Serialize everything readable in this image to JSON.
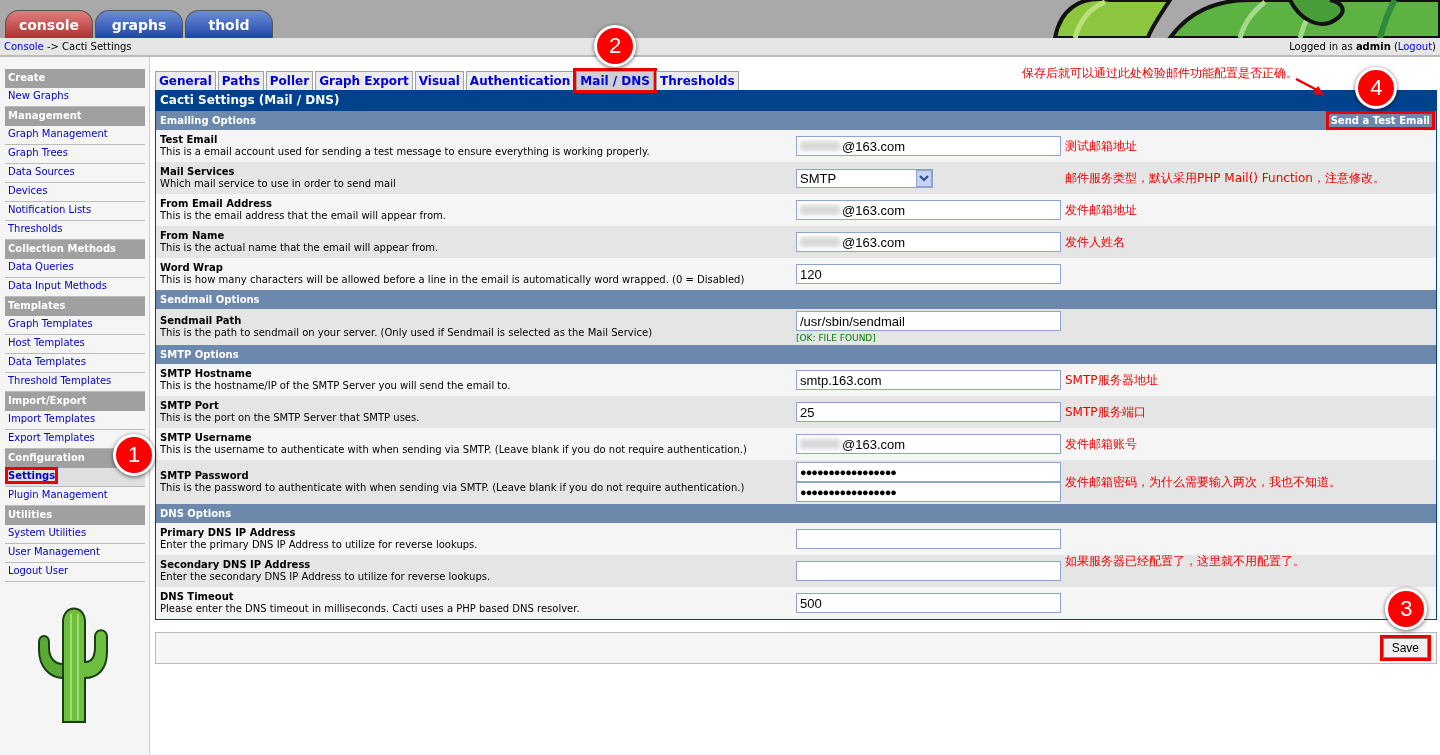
{
  "top_tabs": [
    {
      "label": "console",
      "selected": true
    },
    {
      "label": "graphs",
      "selected": false
    },
    {
      "label": "thold",
      "selected": false
    }
  ],
  "breadcrumb": {
    "link": "Console",
    "rest": "-> Cacti Settings"
  },
  "login": {
    "prefix": "Logged in as",
    "user": "admin",
    "open": "(",
    "logout": "Logout",
    "close": ")"
  },
  "sidebar": [
    {
      "kind": "header",
      "label": "Create"
    },
    {
      "kind": "item",
      "label": "New Graphs",
      "selected": false
    },
    {
      "kind": "header",
      "label": "Management"
    },
    {
      "kind": "item",
      "label": "Graph Management",
      "selected": false
    },
    {
      "kind": "item",
      "label": "Graph Trees",
      "selected": false
    },
    {
      "kind": "item",
      "label": "Data Sources",
      "selected": false
    },
    {
      "kind": "item",
      "label": "Devices",
      "selected": false
    },
    {
      "kind": "item",
      "label": "Notification Lists",
      "selected": false
    },
    {
      "kind": "item",
      "label": "Thresholds",
      "selected": false
    },
    {
      "kind": "header",
      "label": "Collection Methods"
    },
    {
      "kind": "item",
      "label": "Data Queries",
      "selected": false
    },
    {
      "kind": "item",
      "label": "Data Input Methods",
      "selected": false
    },
    {
      "kind": "header",
      "label": "Templates"
    },
    {
      "kind": "item",
      "label": "Graph Templates",
      "selected": false
    },
    {
      "kind": "item",
      "label": "Host Templates",
      "selected": false
    },
    {
      "kind": "item",
      "label": "Data Templates",
      "selected": false
    },
    {
      "kind": "item",
      "label": "Threshold Templates",
      "selected": false
    },
    {
      "kind": "header",
      "label": "Import/Export"
    },
    {
      "kind": "item",
      "label": "Import Templates",
      "selected": false
    },
    {
      "kind": "item",
      "label": "Export Templates",
      "selected": false
    },
    {
      "kind": "header",
      "label": "Configuration"
    },
    {
      "kind": "item",
      "label": "Settings",
      "selected": true,
      "marked": true,
      "callout": "1"
    },
    {
      "kind": "item",
      "label": "Plugin Management",
      "selected": false
    },
    {
      "kind": "header",
      "label": "Utilities"
    },
    {
      "kind": "item",
      "label": "System Utilities",
      "selected": false
    },
    {
      "kind": "item",
      "label": "User Management",
      "selected": false
    },
    {
      "kind": "item",
      "label": "Logout User",
      "selected": false
    }
  ],
  "settings_tabs": [
    {
      "label": "General",
      "selected": false
    },
    {
      "label": "Paths",
      "selected": false
    },
    {
      "label": "Poller",
      "selected": false
    },
    {
      "label": "Graph Export",
      "selected": false
    },
    {
      "label": "Visual",
      "selected": false
    },
    {
      "label": "Authentication",
      "selected": false
    },
    {
      "label": "Mail / DNS",
      "selected": true,
      "marked": true,
      "callout": "2"
    },
    {
      "label": "Thresholds",
      "selected": false
    }
  ],
  "top_note": "保存后就可以通过此处检验邮件功能配置是否正确。",
  "panel_title": "Cacti Settings (Mail / DNS)",
  "sections": [
    {
      "title": "Emailing Options",
      "action": {
        "label": "Send a Test Email",
        "marked": true,
        "callout": "4"
      },
      "rows": [
        {
          "label": "Test Email",
          "description": "This is a email account used for sending a test message to ensure everything is working properly.",
          "kind": "text",
          "redacted": true,
          "value": "@163.com",
          "note": "测试邮箱地址"
        },
        {
          "label": "Mail Services",
          "description": "Which mail service to use in order to send mail",
          "kind": "select",
          "value": "SMTP",
          "note": "邮件服务类型，默认采用PHP Mail() Function，注意修改。"
        },
        {
          "label": "From Email Address",
          "description": "This is the email address that the email will appear from.",
          "kind": "text",
          "redacted": true,
          "value": "@163.com",
          "note": "发件邮箱地址"
        },
        {
          "label": "From Name",
          "description": "This is the actual name that the email will appear from.",
          "kind": "text",
          "redacted": true,
          "value": "@163.com",
          "note": "发件人姓名"
        },
        {
          "label": "Word Wrap",
          "description": "This is how many characters will be allowed before a line in the email is automatically word wrapped. (0 = Disabled)",
          "kind": "text",
          "value": "120"
        }
      ]
    },
    {
      "title": "Sendmail Options",
      "rows": [
        {
          "label": "Sendmail Path",
          "description": "This is the path to sendmail on your server. (Only used if Sendmail is selected as the Mail Service)",
          "kind": "text",
          "value": "/usr/sbin/sendmail",
          "status": "[OK: FILE FOUND]"
        }
      ]
    },
    {
      "title": "SMTP Options",
      "rows": [
        {
          "label": "SMTP Hostname",
          "description": "This is the hostname/IP of the SMTP Server you will send the email to.",
          "kind": "text",
          "value": "smtp.163.com",
          "note": "SMTP服务器地址"
        },
        {
          "label": "SMTP Port",
          "description": "This is the port on the SMTP Server that SMTP uses.",
          "kind": "text",
          "value": "25",
          "note": "SMTP服务端口"
        },
        {
          "label": "SMTP Username",
          "description": "This is the username to authenticate with when sending via SMTP. (Leave blank if you do not require authentication.)",
          "kind": "text",
          "redacted": true,
          "value": "@163.com",
          "note": "发件邮箱账号"
        },
        {
          "label": "SMTP Password",
          "description": "This is the password to authenticate with when sending via SMTP. (Leave blank if you do not require authentication.)",
          "kind": "password",
          "values": [
            "●●●●●●●●●●●●●●●●●",
            "●●●●●●●●●●●●●●●●●"
          ],
          "note": "发件邮箱密码，为什么需要输入两次，我也不知道。"
        }
      ]
    },
    {
      "title": "DNS Options",
      "rows": [
        {
          "label": "Primary DNS IP Address",
          "description": "Enter the primary DNS IP Address to utilize for reverse lookups.",
          "kind": "text"
        },
        {
          "label": "Secondary DNS IP Address",
          "description": "Enter the secondary DNS IP Address to utilize for reverse lookups.",
          "kind": "text",
          "note": "如果服务器已经配置了，这里就不用配置了。",
          "note_raised": true
        },
        {
          "label": "DNS Timeout",
          "description": "Please enter the DNS timeout in milliseconds. Cacti uses a PHP based DNS resolver.",
          "kind": "text",
          "value": "500"
        }
      ]
    }
  ],
  "save": {
    "label": "Save",
    "marked": true,
    "callout": "3"
  }
}
